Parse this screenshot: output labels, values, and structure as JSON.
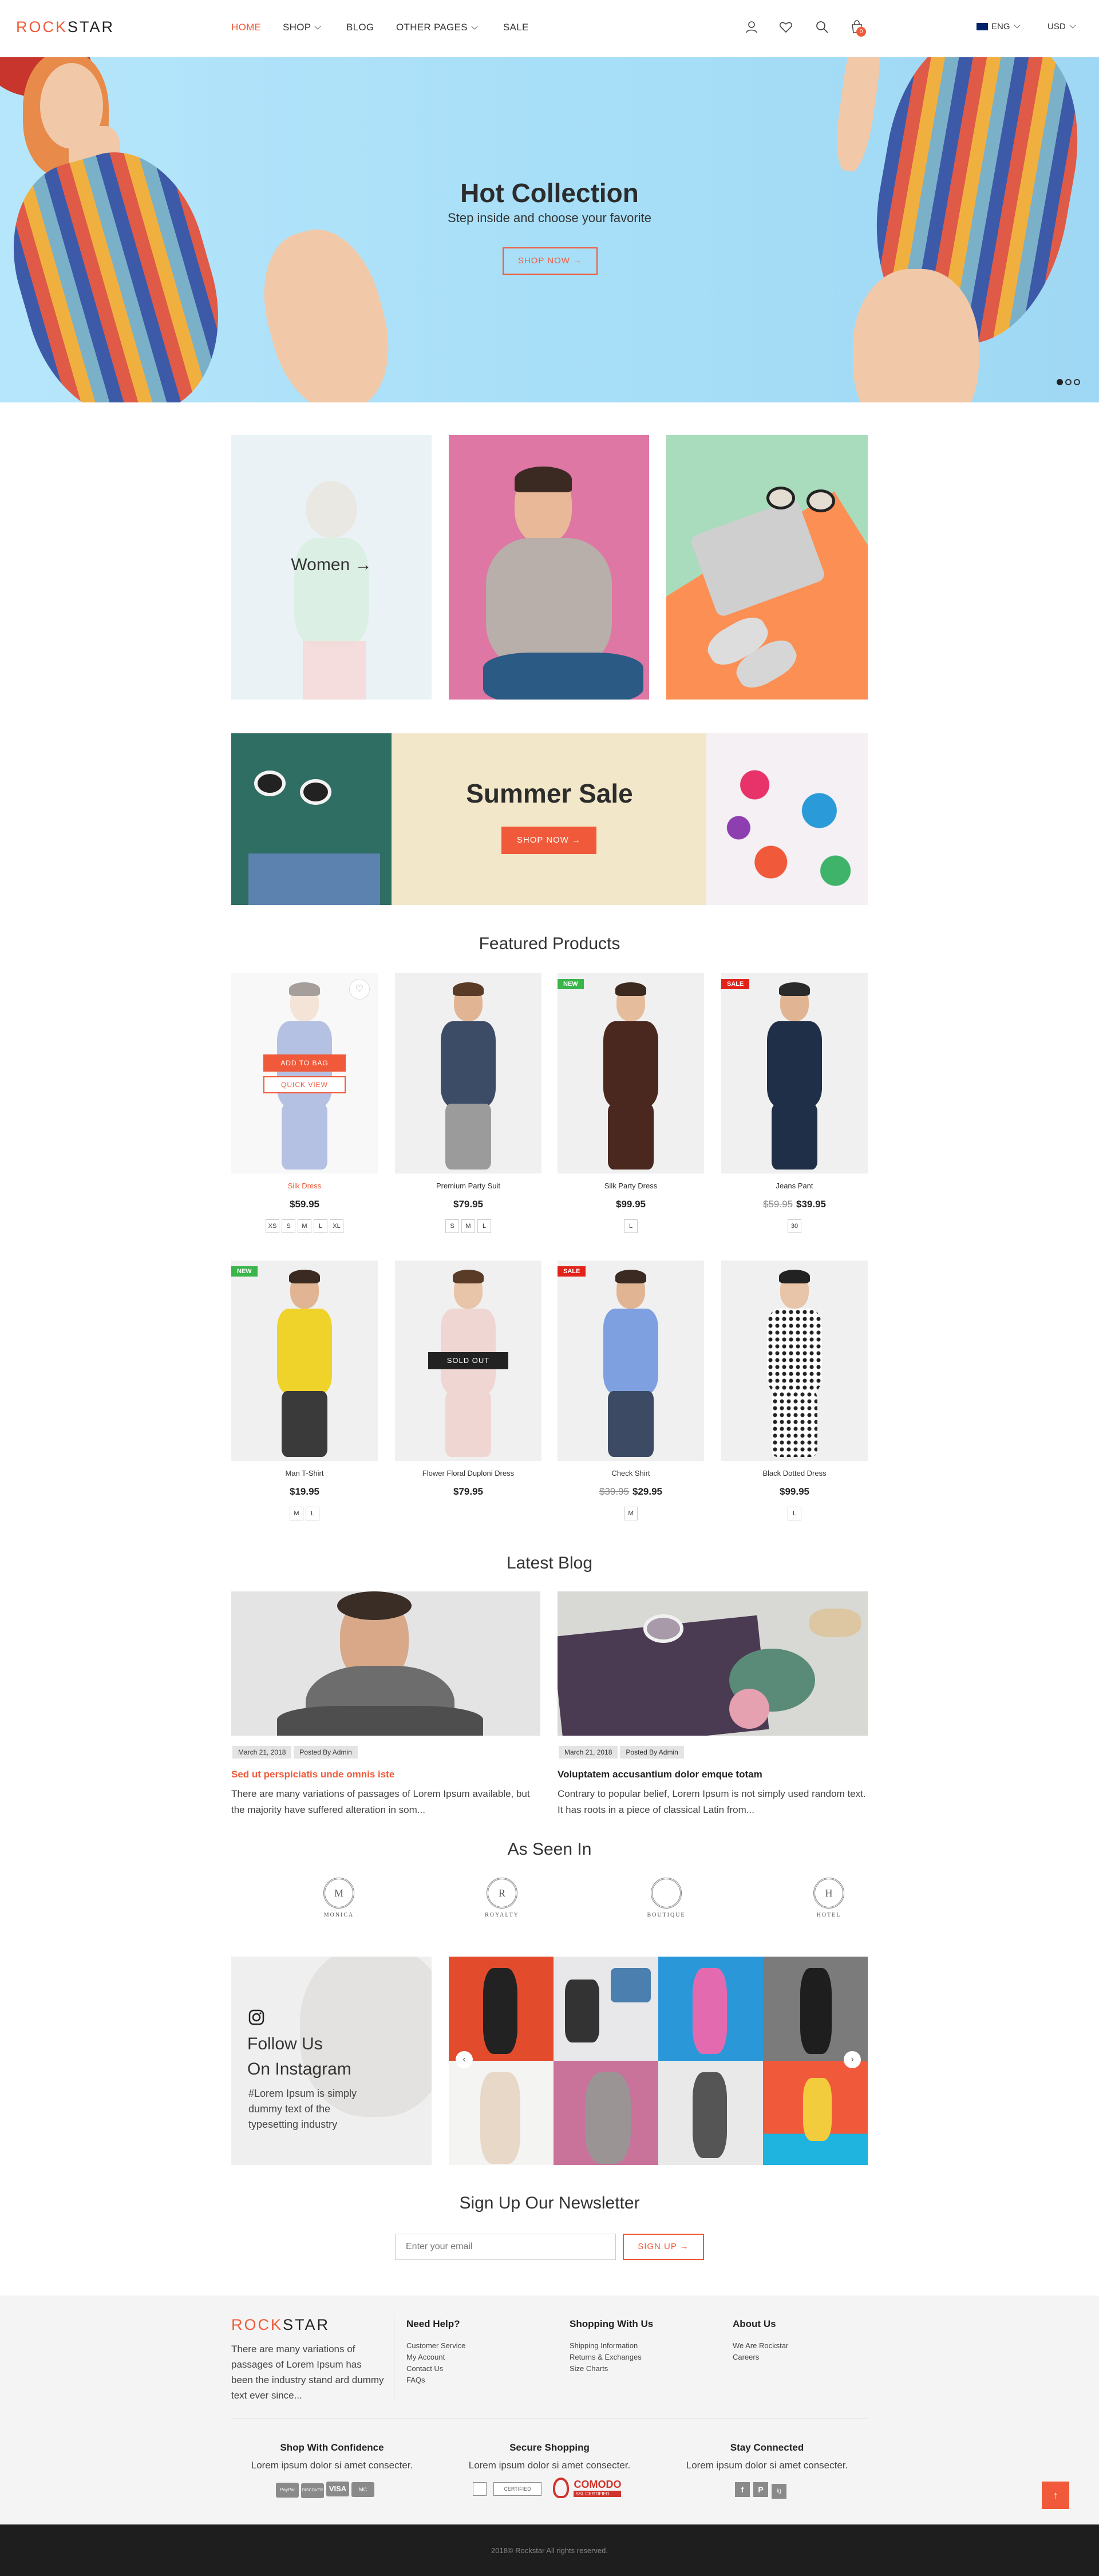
{
  "header": {
    "logo_a": "ROCK",
    "logo_b": "STAR",
    "nav": [
      "HOME",
      "SHOP",
      "BLOG",
      "OTHER PAGES",
      "SALE"
    ],
    "cart_count": "0",
    "language": "ENG",
    "currency": "USD"
  },
  "hero": {
    "title": "Hot Collection",
    "subtitle": "Step inside and choose your favorite",
    "button": "SHOP NOW"
  },
  "categories": {
    "women": "Women"
  },
  "summer": {
    "title": "Summer Sale",
    "button": "SHOP NOW"
  },
  "featured": {
    "title": "Featured Products",
    "add_to_bag": "ADD TO BAG",
    "quick_view": "QUICK VIEW",
    "products": [
      {
        "name": "Silk Dress",
        "price": "$59.95",
        "old": "",
        "sizes": [
          "XS",
          "S",
          "M",
          "L",
          "XL"
        ],
        "badge": ""
      },
      {
        "name": "Premium Party Suit",
        "price": "$79.95",
        "old": "",
        "sizes": [
          "S",
          "M",
          "L"
        ],
        "badge": ""
      },
      {
        "name": "Silk Party Dress",
        "price": "$99.95",
        "old": "",
        "sizes": [
          "L"
        ],
        "badge": "NEW"
      },
      {
        "name": "Jeans Pant",
        "price": "$39.95",
        "old": "$59.95",
        "sizes": [
          "30"
        ],
        "badge": "SALE"
      },
      {
        "name": "Man T-Shirt",
        "price": "$19.95",
        "old": "",
        "sizes": [
          "M",
          "L"
        ],
        "badge": "NEW"
      },
      {
        "name": "Flower Floral Duploni Dress",
        "price": "$79.95",
        "old": "",
        "sizes": [],
        "badge": ""
      },
      {
        "name": "Check Shirt",
        "price": "$29.95",
        "old": "$39.95",
        "sizes": [
          "M"
        ],
        "badge": "SALE"
      },
      {
        "name": "Black Dotted Dress",
        "price": "$99.95",
        "old": "",
        "sizes": [
          "L"
        ],
        "badge": ""
      }
    ],
    "sold_out": "SOLD OUT"
  },
  "blog": {
    "title": "Latest Blog",
    "posts": [
      {
        "date": "March 21, 2018",
        "author": "Posted By Admin",
        "title": "Sed ut perspiciatis unde omnis iste",
        "excerpt": "There are many variations of passages of Lorem Ipsum available, but the majority have suffered alteration in som..."
      },
      {
        "date": "March 21, 2018",
        "author": "Posted By Admin",
        "title": "Voluptatem accusantium dolor emque totam",
        "excerpt": "Contrary to popular belief, Lorem Ipsum is not simply used random text. It has roots in a piece of classical Latin from..."
      }
    ]
  },
  "seen": {
    "title": "As Seen In",
    "brands": [
      "MONICA",
      "ROYALTY",
      "BOUTIQUE",
      "HOTEL"
    ],
    "brand_letters": [
      "M",
      "R",
      "",
      "H"
    ]
  },
  "instagram": {
    "line1": "Follow Us",
    "line2": "On Instagram",
    "text": "#Lorem Ipsum is simply dummy text of the typesetting industry"
  },
  "newsletter": {
    "title": "Sign Up Our Newsletter",
    "placeholder": "Enter your email",
    "button": "SIGN UP"
  },
  "footer": {
    "logo_a": "ROCK",
    "logo_b": "STAR",
    "about": "There are many variations of passages of Lorem Ipsum has been the industry stand ard dummy text ever since...",
    "cols": [
      {
        "title": "Need Help?",
        "links": [
          "Customer Service",
          "My Account",
          "Contact Us",
          "FAQs"
        ]
      },
      {
        "title": "Shopping With Us",
        "links": [
          "Shipping Information",
          "Returns & Exchanges",
          "Size Charts"
        ]
      },
      {
        "title": "About Us",
        "links": [
          "We Are Rockstar",
          "Careers"
        ]
      }
    ],
    "bottom_cols": [
      {
        "title": "Shop With Confidence",
        "text": "Lorem ipsum dolor si amet consecter."
      },
      {
        "title": "Secure Shopping",
        "text": "Lorem ipsum dolor si amet consecter."
      },
      {
        "title": "Stay Connected",
        "text": "Lorem ipsum dolor si amet consecter."
      }
    ],
    "payments": [
      "PayPal",
      "DISCOVER",
      "VISA",
      "MC"
    ],
    "comodo": "COMODO",
    "comodo_sub": "SSL CERTIFIED",
    "certified": "CERTIFIED",
    "social": [
      "f",
      "P",
      "ig"
    ],
    "copyright": "2018© Rockstar All rights reserved."
  },
  "colors": {
    "accent": "#f05a3a",
    "hero_bg": "#a8dff8",
    "footer_bg": "#f4f4f4",
    "bottom_bg": "#1e1e1e"
  }
}
